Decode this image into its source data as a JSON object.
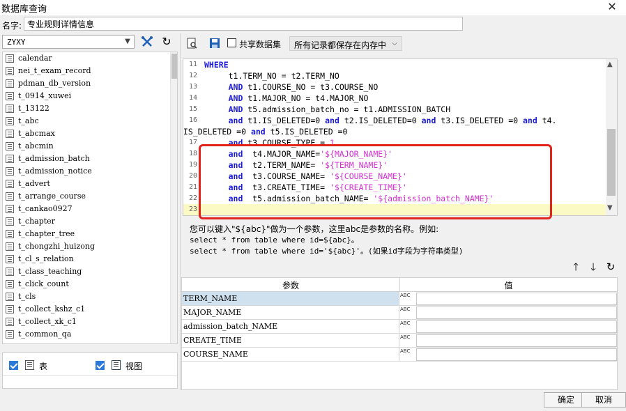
{
  "window": {
    "title": "数据库查询"
  },
  "name_field": {
    "label": "名字:",
    "value": "专业规则详情信息"
  },
  "left": {
    "schema": "ZYXY",
    "tables": [
      "calendar",
      "nei_t_exam_record",
      "pdman_db_version",
      "t_0914_xuwei",
      "t_13122",
      "t_abc",
      "t_abcmax",
      "t_abcmin",
      "t_admission_batch",
      "t_admission_notice",
      "t_advert",
      "t_arrange_course",
      "t_cankao0927",
      "t_chapter",
      "t_chapter_tree",
      "t_chongzhi_huizong",
      "t_cl_s_relation",
      "t_class_teaching",
      "t_click_count",
      "t_cls",
      "t_collect_kshz_c1",
      "t_collect_xk_c1",
      "t_common_qa"
    ],
    "filter_table_label": "表",
    "filter_view_label": "视图"
  },
  "toolbar": {
    "share_label": "共享数据集",
    "memory_option": "所有记录都保存在内存中"
  },
  "sql_lines": [
    {
      "n": "11",
      "segs": [
        {
          "t": "WHERE",
          "c": "kw"
        }
      ]
    },
    {
      "n": "12",
      "segs": [
        {
          "t": "     t1.TERM_NO = t2.TERM_NO",
          "c": ""
        }
      ]
    },
    {
      "n": "13",
      "segs": [
        {
          "t": "     ",
          "c": ""
        },
        {
          "t": "AND",
          "c": "kw"
        },
        {
          "t": " t1.COURSE_NO = t3.COURSE_NO",
          "c": ""
        }
      ]
    },
    {
      "n": "14",
      "segs": [
        {
          "t": "     ",
          "c": ""
        },
        {
          "t": "AND",
          "c": "kw"
        },
        {
          "t": " t1.MAJOR_NO = t4.MAJOR_NO",
          "c": ""
        }
      ]
    },
    {
      "n": "15",
      "segs": [
        {
          "t": "     ",
          "c": ""
        },
        {
          "t": "AND",
          "c": "kw"
        },
        {
          "t": " t5.admission_batch_no = t1.ADMISSION_BATCH",
          "c": ""
        }
      ]
    },
    {
      "n": "16",
      "segs": [
        {
          "t": "     ",
          "c": ""
        },
        {
          "t": "and",
          "c": "kw"
        },
        {
          "t": " t1.IS_DELETED=0 ",
          "c": ""
        },
        {
          "t": "and",
          "c": "kw"
        },
        {
          "t": " t2.IS_DELETED=0 ",
          "c": ""
        },
        {
          "t": "and",
          "c": "kw"
        },
        {
          "t": " t3.IS_DELETED =0 ",
          "c": ""
        },
        {
          "t": "and",
          "c": "kw"
        },
        {
          "t": " t4.",
          "c": ""
        }
      ]
    },
    {
      "n": "",
      "wrap": true,
      "segs": [
        {
          "t": "IS_DELETED =0 ",
          "c": ""
        },
        {
          "t": "and",
          "c": "kw"
        },
        {
          "t": " t5.IS_DELETED =0",
          "c": ""
        }
      ]
    },
    {
      "n": "17",
      "segs": [
        {
          "t": "     ",
          "c": ""
        },
        {
          "t": "and",
          "c": "kw"
        },
        {
          "t": " t3.COURSE_TYPE = ",
          "c": ""
        },
        {
          "t": "1",
          "c": "num"
        }
      ]
    },
    {
      "n": "18",
      "segs": [
        {
          "t": "     ",
          "c": ""
        },
        {
          "t": "and",
          "c": "kw"
        },
        {
          "t": "  t4.MAJOR_NAME=",
          "c": ""
        },
        {
          "t": "'${MAJOR_NAME}'",
          "c": "str"
        }
      ]
    },
    {
      "n": "19",
      "segs": [
        {
          "t": "     ",
          "c": ""
        },
        {
          "t": "and",
          "c": "kw"
        },
        {
          "t": "  t2.TERM_NAME= ",
          "c": ""
        },
        {
          "t": "'${TERM_NAME}'",
          "c": "str"
        }
      ]
    },
    {
      "n": "20",
      "segs": [
        {
          "t": "     ",
          "c": ""
        },
        {
          "t": "and",
          "c": "kw"
        },
        {
          "t": "  t3.COURSE_NAME= ",
          "c": ""
        },
        {
          "t": "'${COURSE_NAME}'",
          "c": "str"
        }
      ]
    },
    {
      "n": "21",
      "segs": [
        {
          "t": "     ",
          "c": ""
        },
        {
          "t": "and",
          "c": "kw"
        },
        {
          "t": "  t3.CREATE_TIME= ",
          "c": ""
        },
        {
          "t": "'${CREATE_TIME}'",
          "c": "str"
        }
      ]
    },
    {
      "n": "22",
      "segs": [
        {
          "t": "     ",
          "c": ""
        },
        {
          "t": "and",
          "c": "kw"
        },
        {
          "t": "  t5.admission_batch_NAME= ",
          "c": ""
        },
        {
          "t": "'${admission_batch_NAME}'",
          "c": "str"
        }
      ]
    },
    {
      "n": "23",
      "segs": []
    }
  ],
  "hint": {
    "line1": "您可以键入\"${abc}\"做为一个参数，这里abc是参数的名称。例如:",
    "line2": "select * from table where id=${abc}。",
    "line3": "select * from table where id='${abc}'。(如果id字段为字符串类型)"
  },
  "params": {
    "col_name": "参数",
    "col_value": "值",
    "type_label": "ABC",
    "rows": [
      "TERM_NAME",
      "MAJOR_NAME",
      "admission_batch_NAME",
      "CREATE_TIME",
      "COURSE_NAME"
    ]
  },
  "footer": {
    "ok": "确定",
    "cancel": "取消"
  },
  "colors": {
    "keyword": "#1b1bd6",
    "string": "#d42fd4",
    "highlight_box": "#e2231a",
    "current_line": "#fcfac4",
    "selected_row": "#cfe1ee"
  },
  "icons": [
    "preview-icon",
    "save-icon",
    "filter-icon",
    "refresh-icon",
    "arrow-up-icon",
    "arrow-down-icon",
    "table-icon",
    "view-icon",
    "close-icon",
    "dropdown-arrow-icon"
  ]
}
